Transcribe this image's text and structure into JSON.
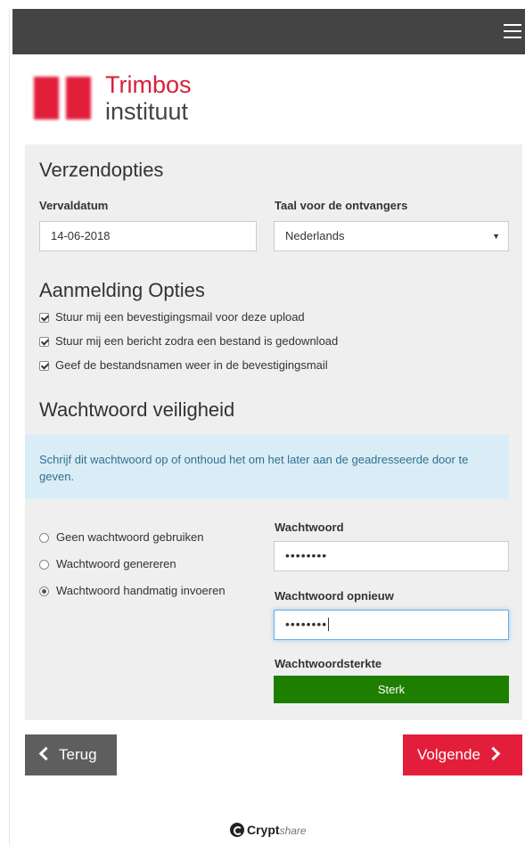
{
  "brand": {
    "name_line1": "Trimbos",
    "name_line2": "instituut"
  },
  "send_options": {
    "heading": "Verzendopties",
    "expiry_label": "Vervaldatum",
    "expiry_value": "14-06-2018",
    "language_label": "Taal voor de ontvangers",
    "language_value": "Nederlands"
  },
  "notify": {
    "heading": "Aanmelding Opties",
    "options": [
      {
        "label": "Stuur mij een bevestigingsmail voor deze upload",
        "checked": true
      },
      {
        "label": "Stuur mij een bericht zodra een bestand is gedownload",
        "checked": true
      },
      {
        "label": "Geef de bestandsnamen weer in de bevestigingsmail",
        "checked": true
      }
    ]
  },
  "password": {
    "heading": "Wachtwoord veiligheid",
    "info": "Schrijf dit wachtwoord op of onthoud het om het later aan de geadresseerde door te geven.",
    "radio_options": [
      {
        "label": "Geen wachtwoord gebruiken",
        "selected": false
      },
      {
        "label": "Wachtwoord genereren",
        "selected": false
      },
      {
        "label": "Wachtwoord handmatig invoeren",
        "selected": true
      }
    ],
    "pw_label": "Wachtwoord",
    "pw_value": "••••••••",
    "pw_repeat_label": "Wachtwoord opnieuw",
    "pw_repeat_value": "••••••••",
    "strength_label": "Wachtwoordsterkte",
    "strength_value": "Sterk"
  },
  "buttons": {
    "back": "Terug",
    "next": "Volgende"
  },
  "footer": {
    "logo_bold": "Crypt",
    "logo_light": "share"
  },
  "colors": {
    "accent": "#e31e3a",
    "navbar": "#444444",
    "panel": "#efefef",
    "strength": "#1e7e00",
    "info_bg": "#d9edf7"
  }
}
